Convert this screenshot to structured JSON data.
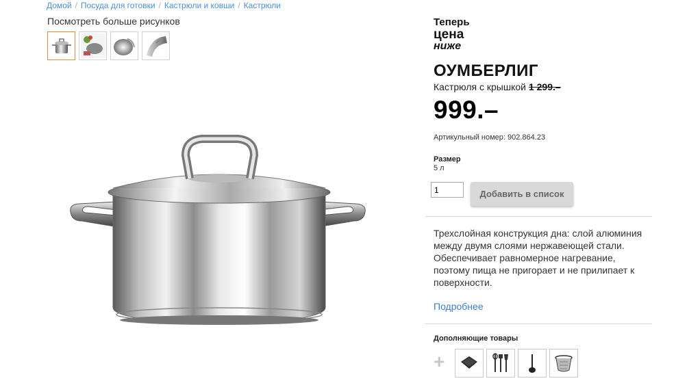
{
  "breadcrumb": {
    "items": [
      "Домой",
      "Посуда для готовки",
      "Кастрюли и ковши",
      "Кастрюли"
    ],
    "separator": "/"
  },
  "gallery": {
    "more_images_label": "Посмотреть больше рисунков",
    "thumbnails": [
      "pot-thumbnail",
      "cooking-scene-thumbnail",
      "pot-lid-thumbnail",
      "pot-handle-thumbnail"
    ],
    "selected_index": 0
  },
  "promo": {
    "line1": "Теперь",
    "line2": "цена",
    "line3": "ниже"
  },
  "product": {
    "name": "ОУМБЕРЛИГ",
    "type": "Кастрюля с крышкой",
    "old_price": "1 299.–",
    "price": "999.–",
    "article": "Артикульный номер: 902.864.23",
    "size_label": "Размер",
    "size_value": "5 л",
    "quantity": "1",
    "add_button_label": "Добавить в список",
    "description": "Трехслойная конструкция дна: слой алюминия между двумя слоями нержавеющей стали. Обеспечивает равномерное нагревание, поэтому пища не пригорает и не прилипает к поверхности.",
    "more_link": "Подробнее"
  },
  "complementary": {
    "title": "Дополняющие товары",
    "plus_symbol": "+",
    "items": [
      "trivet",
      "kitchen-utensils",
      "ladle",
      "colander-insert"
    ]
  },
  "colors": {
    "link": "#4a8fd8",
    "thumb_active_border": "#e08a3c",
    "button_bg": "#d9d9d9"
  }
}
